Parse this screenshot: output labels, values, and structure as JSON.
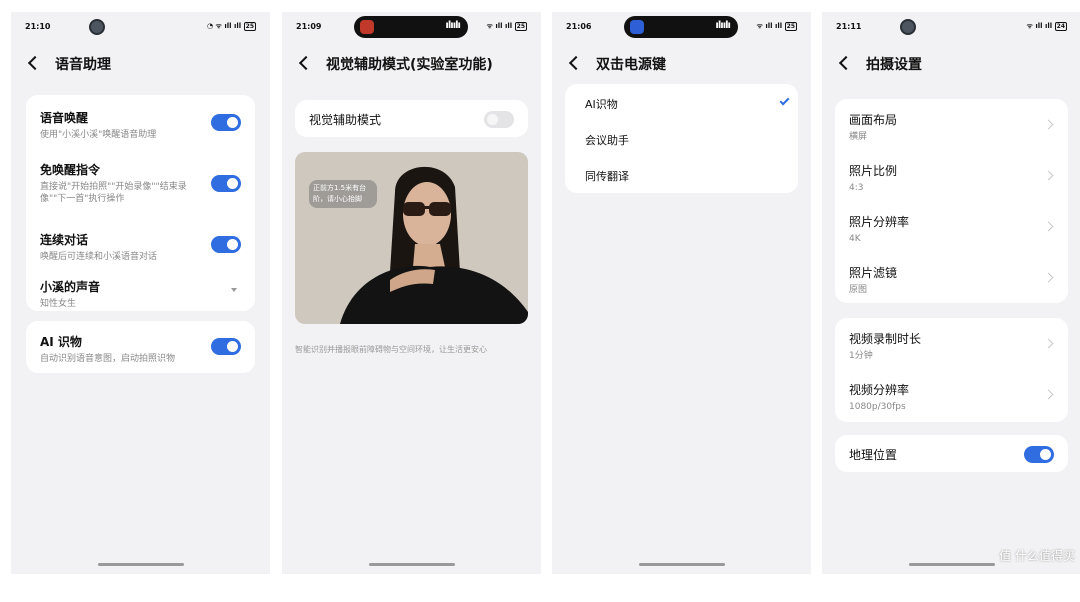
{
  "screens": [
    {
      "status_time": "21:10",
      "battery": "25",
      "title": "语音助理",
      "cards": [
        {
          "rows": [
            {
              "title": "语音唤醒",
              "sub": "使用\"小溪小溪\"唤醒语音助理",
              "control": "toggle-on"
            },
            {
              "title": "免唤醒指令",
              "sub": "直接说\"开始拍照\"\"开始录像\"\"结束录像\"\"下一首\"执行操作",
              "control": "toggle-on"
            },
            {
              "title": "连续对话",
              "sub": "唤醒后可连续和小溪语音对话",
              "control": "toggle-on"
            },
            {
              "title": "小溪的声音",
              "sub": "知性女生",
              "control": "dropdown"
            }
          ]
        },
        {
          "rows": [
            {
              "title": "AI 识物",
              "sub": "自动识别语音意图，启动拍照识物",
              "control": "toggle-on"
            }
          ]
        }
      ]
    },
    {
      "status_time": "21:09",
      "battery": "25",
      "title": "视觉辅助模式(实验室功能)",
      "toggle_label": "视觉辅助模式",
      "toggle_state": "off",
      "promo_bubble": "正前方1.5米有台阶，请小心抬脚",
      "caption": "智能识别并播报眼前障碍物与空间环境，让生活更安心"
    },
    {
      "status_time": "21:06",
      "battery": "25",
      "title": "双击电源键",
      "options": [
        "AI识物",
        "会议助手",
        "同传翻译"
      ],
      "selected_option": "AI识物"
    },
    {
      "status_time": "21:11",
      "battery": "24",
      "title": "拍摄设置",
      "cards": [
        {
          "rows": [
            {
              "title": "画面布局",
              "sub": "横屏"
            },
            {
              "title": "照片比例",
              "sub": "4:3"
            },
            {
              "title": "照片分辨率",
              "sub": "4K"
            },
            {
              "title": "照片滤镜",
              "sub": "原图"
            }
          ]
        },
        {
          "rows": [
            {
              "title": "视频录制时长",
              "sub": "1分钟"
            },
            {
              "title": "视频分辨率",
              "sub": "1080p/30fps"
            }
          ]
        },
        {
          "rows": [
            {
              "title": "地理位置",
              "control": "toggle-on"
            }
          ]
        }
      ]
    }
  ],
  "watermark": "值 什么值得买",
  "colors": {
    "accent": "#2f6de0",
    "background": "#f2f2f4",
    "card": "#ffffff"
  }
}
